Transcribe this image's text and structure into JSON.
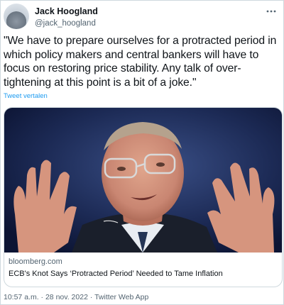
{
  "author": {
    "name": "Jack Hoogland",
    "handle": "@jack_hoogland"
  },
  "tweet": {
    "text": "\"We have to prepare ourselves for a protracted period in which policy makers and central bankers will have to focus on restoring price stability. Any talk of over-tightening at this point is a bit of a joke.\"",
    "translate_label": "Tweet vertalen"
  },
  "link_card": {
    "domain": "bloomberg.com",
    "title": "ECB's Knot Says ‘Protracted Period’ Needed to Tame Inflation"
  },
  "meta": {
    "time": "10:57 a.m.",
    "sep1": " · ",
    "date": "28 nov. 2022",
    "sep2": " · ",
    "source": "Twitter Web App"
  },
  "colors": {
    "accent": "#1d9bf0",
    "muted": "#536471",
    "text": "#0f1419",
    "border": "#cfd9de"
  },
  "icons": {
    "more": "more-icon",
    "avatar": "avatar"
  }
}
